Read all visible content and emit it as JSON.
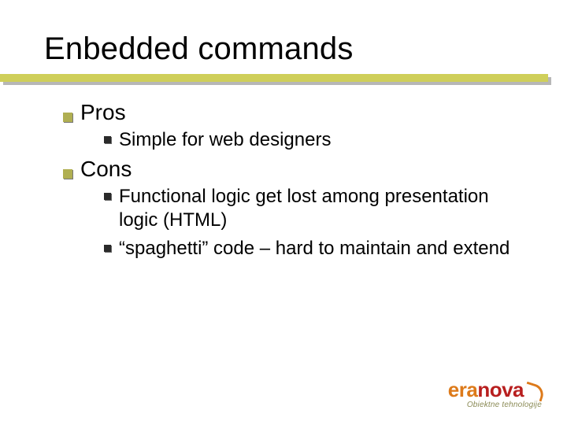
{
  "title": "Enbedded commands",
  "sections": [
    {
      "heading": "Pros",
      "items": [
        "Simple for web designers"
      ]
    },
    {
      "heading": "Cons",
      "items": [
        "Functional logic get lost among presentation logic (HTML)",
        "“spaghetti” code – hard to maintain and extend"
      ]
    }
  ],
  "logo": {
    "part1": "era",
    "part2": "nova",
    "tagline": "Obiektne tehnologije"
  }
}
